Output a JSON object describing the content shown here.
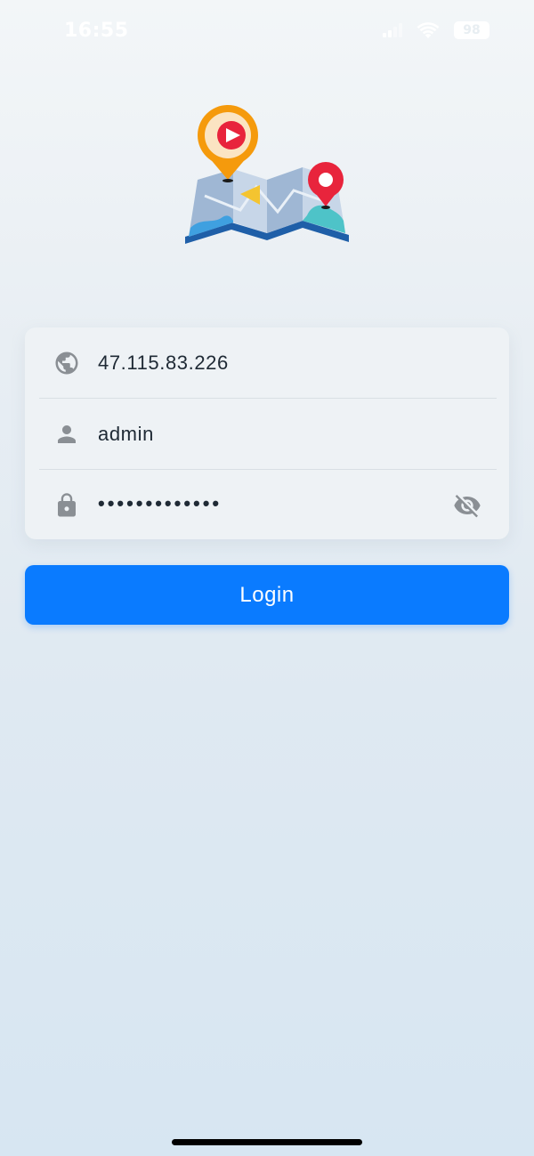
{
  "status_bar": {
    "time": "16:55",
    "battery": "98"
  },
  "icons": {
    "signal": "cellular-signal-icon",
    "wifi": "wifi-icon",
    "battery": "battery-icon",
    "server": "globe-icon",
    "user": "person-icon",
    "password": "lock-icon",
    "toggle": "eye-off-icon",
    "logo": "map-location-video-logo"
  },
  "form": {
    "server": "47.115.83.226",
    "username": "admin",
    "password": "•••••••••••••"
  },
  "login_button": {
    "label": "Login"
  },
  "colors": {
    "accent": "#0a7bff",
    "icon_gray": "#8a8f94",
    "card": "#eef2f5"
  }
}
